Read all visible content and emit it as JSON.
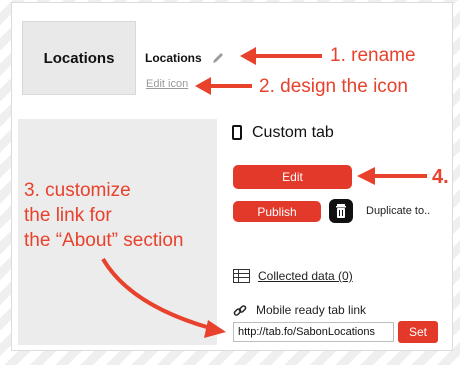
{
  "tab": {
    "thumbnail_label": "Locations",
    "name": "Locations",
    "edit_icon_link": "Edit icon",
    "type_label": "Custom tab"
  },
  "actions": {
    "edit_label": "Edit",
    "publish_label": "Publish",
    "duplicate_label": "Duplicate to.."
  },
  "data_section": {
    "collected_data_link": "Collected data (0)"
  },
  "mobile_link": {
    "label": "Mobile ready tab link",
    "url_value": "http://tab.fo/SabonLocations",
    "set_label": "Set"
  },
  "annotations": {
    "step1": "1. rename",
    "step2": "2. design the icon",
    "step3_lines": [
      "3. customize",
      "the link for",
      "the “About” section"
    ],
    "step4": "4."
  },
  "icons": [
    "pencil-icon",
    "mobile-device-icon",
    "trash-icon",
    "table-icon",
    "link-icon"
  ],
  "colors": {
    "accent": "#e2392a",
    "annotation": "#e8412c"
  }
}
